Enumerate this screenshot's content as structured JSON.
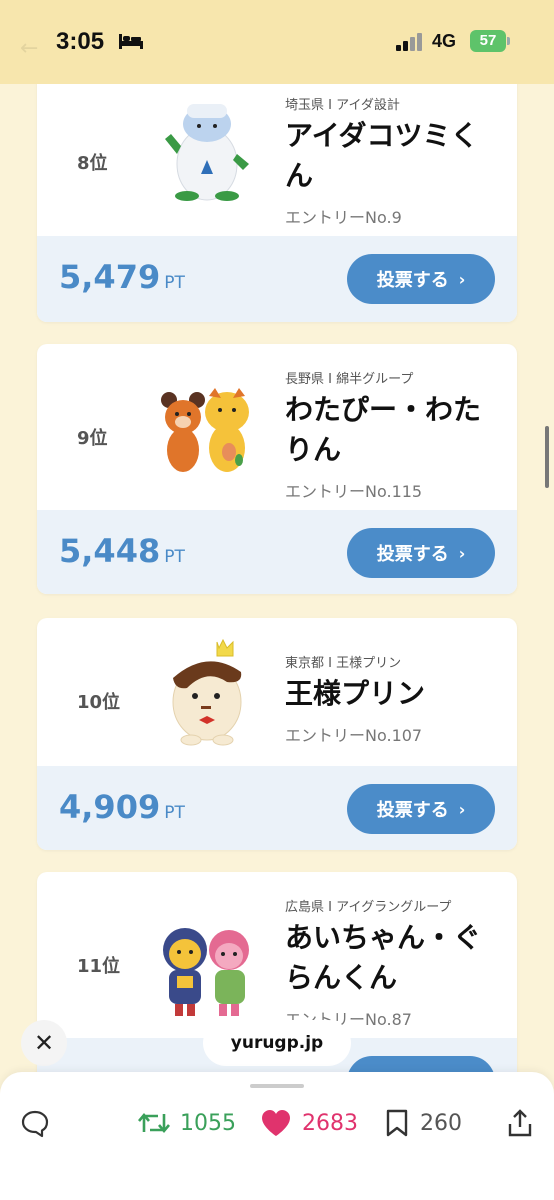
{
  "status_bar": {
    "time": "3:05",
    "network": "4G",
    "battery": "57"
  },
  "entries": [
    {
      "rank": "8位",
      "prefecture_org": "埼玉県 I アイダ設計",
      "name": "アイダコツミくん",
      "entry": "エントリーNo.9",
      "points": "5,479",
      "unit": "PT",
      "vote_label": "投票する"
    },
    {
      "rank": "9位",
      "prefecture_org": "長野県 I 綿半グループ",
      "name": "わたぴー・わたりん",
      "entry": "エントリーNo.115",
      "points": "5,448",
      "unit": "PT",
      "vote_label": "投票する"
    },
    {
      "rank": "10位",
      "prefecture_org": "東京都 I 王様プリン",
      "name": "王様プリン",
      "entry": "エントリーNo.107",
      "points": "4,909",
      "unit": "PT",
      "vote_label": "投票する"
    },
    {
      "rank": "11位",
      "prefecture_org": "広島県 I アイグラングループ",
      "name": "あいちゃん・ぐらんくん",
      "entry": "エントリーNo.87",
      "points": "",
      "unit": "",
      "vote_label": ""
    }
  ],
  "browser": {
    "url": "yurugp.jp"
  },
  "post_actions": {
    "reposts": "1055",
    "likes": "2683",
    "bookmarks": "260"
  },
  "icons": {
    "reply": "reply-icon",
    "repost": "repost-icon",
    "like": "heart-icon",
    "bookmark": "bookmark-icon",
    "share": "share-icon",
    "close": "close-icon"
  },
  "colors": {
    "status_bg": "#f7e6ad",
    "page_bg": "#fbf3d8",
    "accent_blue": "#4b8cc9",
    "points_blue": "#4a8ac7",
    "repost_green": "#3aa05a",
    "like_pink": "#e0336d"
  }
}
